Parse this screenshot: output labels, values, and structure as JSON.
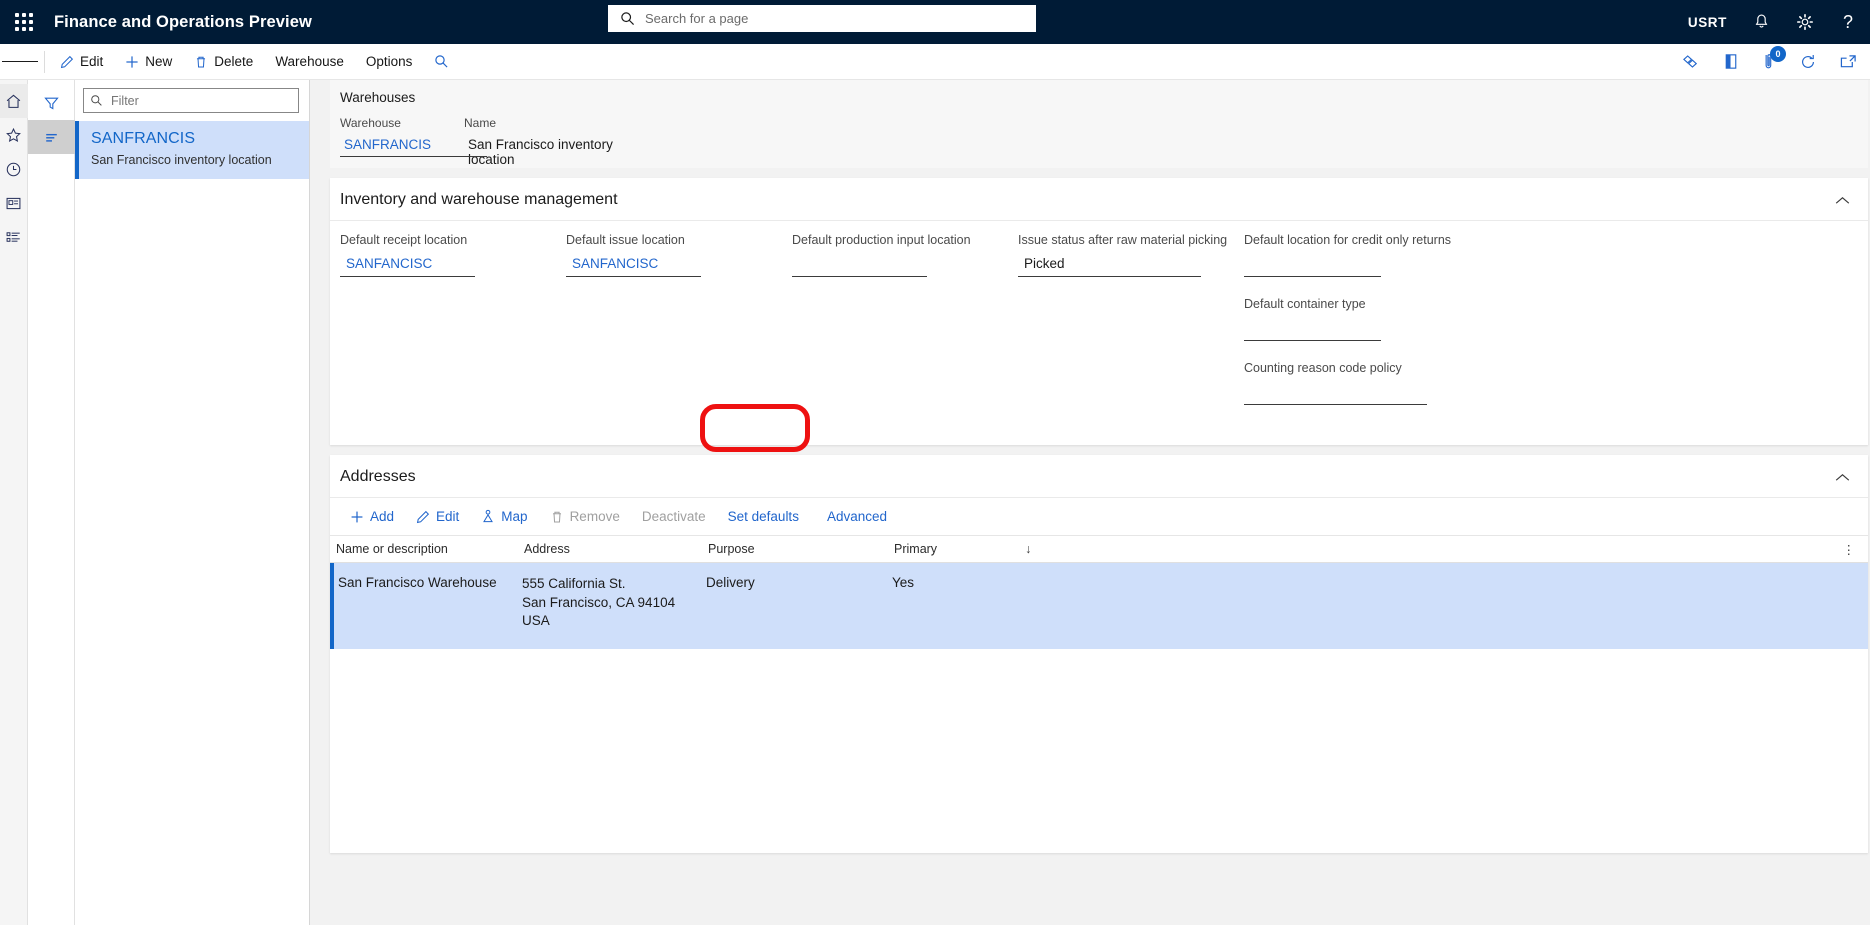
{
  "topbar": {
    "app_title": "Finance and Operations Preview",
    "waffle_icon": "app-launcher-icon",
    "search_placeholder": "Search for a page",
    "search_value": "",
    "search_icon": "search-icon",
    "user_initials": "USRT",
    "notifications_icon": "bell-icon",
    "settings_icon": "gear-icon",
    "help_icon": "question-mark-icon"
  },
  "commandbar": {
    "hamburger_icon": "hamburger-menu-icon",
    "items": [
      {
        "label": "Edit",
        "icon": "pencil-icon"
      },
      {
        "label": "New",
        "icon": "plus-icon"
      },
      {
        "label": "Delete",
        "icon": "trash-icon"
      },
      {
        "label": "Warehouse",
        "icon": ""
      },
      {
        "label": "Options",
        "icon": ""
      }
    ],
    "search_icon": "search-icon",
    "right_icons": [
      {
        "name": "personalize-icon"
      },
      {
        "name": "attachments-icon"
      },
      {
        "name": "notes-icon",
        "badge": "0"
      },
      {
        "name": "refresh-icon"
      },
      {
        "name": "open-in-new-window-icon"
      }
    ]
  },
  "nav_rail": {
    "items": [
      {
        "name": "home-icon",
        "active": true
      },
      {
        "name": "favorites-star-icon",
        "active": false
      },
      {
        "name": "recent-clock-icon",
        "active": false
      },
      {
        "name": "workspaces-icon",
        "active": false
      },
      {
        "name": "modules-list-icon",
        "active": false
      }
    ]
  },
  "filter_rail": {
    "items": [
      {
        "name": "filter-funnel-icon",
        "selected": false
      },
      {
        "name": "list-view-icon",
        "selected": true
      }
    ]
  },
  "list_pane": {
    "filter": {
      "placeholder": "Filter",
      "value": "",
      "icon": "search-icon"
    },
    "rows": [
      {
        "title": "SANFRANCIS",
        "subtitle": "San Francisco inventory location",
        "selected": true
      }
    ]
  },
  "header_card": {
    "caption": "Warehouses",
    "fields": [
      {
        "label": "Warehouse",
        "value": "SANFRANCIS",
        "is_link": true
      },
      {
        "label": "Name",
        "value": "San Francisco inventory location",
        "is_link": false
      }
    ]
  },
  "inventory_section": {
    "title": "Inventory and warehouse management",
    "collapse_icon": "chevron-up-icon",
    "columns": [
      {
        "fields": [
          {
            "label": "Default receipt location",
            "value": "SANFANCISC",
            "is_link": true
          }
        ]
      },
      {
        "fields": [
          {
            "label": "Default issue location",
            "value": "SANFANCISC",
            "is_link": true
          }
        ]
      },
      {
        "fields": [
          {
            "label": "Default production input location",
            "value": "",
            "is_link": false
          }
        ]
      },
      {
        "fields": [
          {
            "label": "Issue status after raw material picking",
            "value": "Picked",
            "is_link": false
          }
        ]
      },
      {
        "fields": [
          {
            "label": "Default location for credit only returns",
            "value": "",
            "is_link": false
          },
          {
            "label": "Default container type",
            "value": "",
            "is_link": false
          },
          {
            "label": "Counting reason code policy",
            "value": "",
            "is_link": false
          }
        ]
      }
    ]
  },
  "addresses_section": {
    "title": "Addresses",
    "collapse_icon": "chevron-up-icon",
    "toolbar": [
      {
        "label": "Add",
        "icon": "plus-icon",
        "disabled": false
      },
      {
        "label": "Edit",
        "icon": "pencil-icon",
        "disabled": false
      },
      {
        "label": "Map",
        "icon": "map-pin-icon",
        "disabled": false
      },
      {
        "label": "Remove",
        "icon": "trash-icon",
        "disabled": true
      },
      {
        "label": "Deactivate",
        "icon": "",
        "disabled": true
      },
      {
        "label": "Set defaults",
        "icon": "",
        "disabled": false
      },
      {
        "label": "Advanced",
        "icon": "",
        "disabled": false
      }
    ],
    "grid": {
      "columns": [
        "Name or description",
        "Address",
        "Purpose",
        "Primary"
      ],
      "sort_indicator": "↓",
      "overflow_icon": "grid-options-icon",
      "rows": [
        {
          "name": "San Francisco Warehouse",
          "address_lines": [
            "555 California St.",
            "San Francisco, CA 94104",
            "USA"
          ],
          "purpose": "Delivery",
          "primary": "Yes",
          "selected": true
        }
      ]
    }
  },
  "annotation": {
    "shape": "rounded-rect",
    "color": "#ee1111",
    "target": "Advanced"
  }
}
